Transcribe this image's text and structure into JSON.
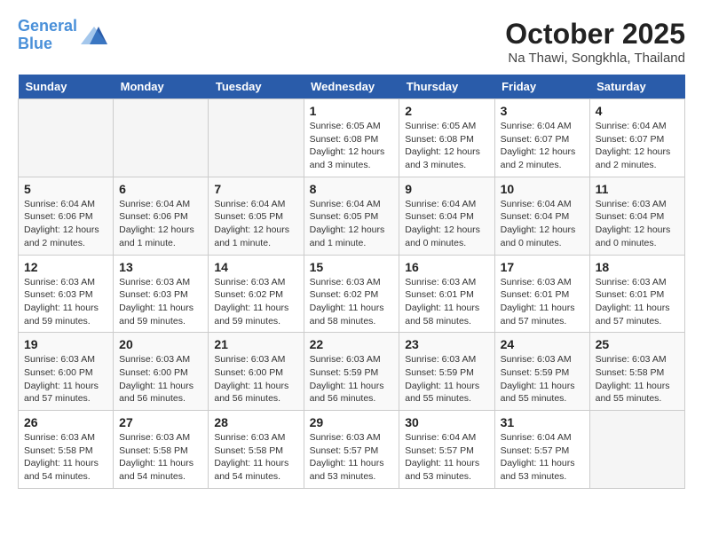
{
  "header": {
    "logo_line1": "General",
    "logo_line2": "Blue",
    "month_year": "October 2025",
    "location": "Na Thawi, Songkhla, Thailand"
  },
  "days_of_week": [
    "Sunday",
    "Monday",
    "Tuesday",
    "Wednesday",
    "Thursday",
    "Friday",
    "Saturday"
  ],
  "weeks": [
    [
      {
        "num": "",
        "info": ""
      },
      {
        "num": "",
        "info": ""
      },
      {
        "num": "",
        "info": ""
      },
      {
        "num": "1",
        "info": "Sunrise: 6:05 AM\nSunset: 6:08 PM\nDaylight: 12 hours and 3 minutes."
      },
      {
        "num": "2",
        "info": "Sunrise: 6:05 AM\nSunset: 6:08 PM\nDaylight: 12 hours and 3 minutes."
      },
      {
        "num": "3",
        "info": "Sunrise: 6:04 AM\nSunset: 6:07 PM\nDaylight: 12 hours and 2 minutes."
      },
      {
        "num": "4",
        "info": "Sunrise: 6:04 AM\nSunset: 6:07 PM\nDaylight: 12 hours and 2 minutes."
      }
    ],
    [
      {
        "num": "5",
        "info": "Sunrise: 6:04 AM\nSunset: 6:06 PM\nDaylight: 12 hours and 2 minutes."
      },
      {
        "num": "6",
        "info": "Sunrise: 6:04 AM\nSunset: 6:06 PM\nDaylight: 12 hours and 1 minute."
      },
      {
        "num": "7",
        "info": "Sunrise: 6:04 AM\nSunset: 6:05 PM\nDaylight: 12 hours and 1 minute."
      },
      {
        "num": "8",
        "info": "Sunrise: 6:04 AM\nSunset: 6:05 PM\nDaylight: 12 hours and 1 minute."
      },
      {
        "num": "9",
        "info": "Sunrise: 6:04 AM\nSunset: 6:04 PM\nDaylight: 12 hours and 0 minutes."
      },
      {
        "num": "10",
        "info": "Sunrise: 6:04 AM\nSunset: 6:04 PM\nDaylight: 12 hours and 0 minutes."
      },
      {
        "num": "11",
        "info": "Sunrise: 6:03 AM\nSunset: 6:04 PM\nDaylight: 12 hours and 0 minutes."
      }
    ],
    [
      {
        "num": "12",
        "info": "Sunrise: 6:03 AM\nSunset: 6:03 PM\nDaylight: 11 hours and 59 minutes."
      },
      {
        "num": "13",
        "info": "Sunrise: 6:03 AM\nSunset: 6:03 PM\nDaylight: 11 hours and 59 minutes."
      },
      {
        "num": "14",
        "info": "Sunrise: 6:03 AM\nSunset: 6:02 PM\nDaylight: 11 hours and 59 minutes."
      },
      {
        "num": "15",
        "info": "Sunrise: 6:03 AM\nSunset: 6:02 PM\nDaylight: 11 hours and 58 minutes."
      },
      {
        "num": "16",
        "info": "Sunrise: 6:03 AM\nSunset: 6:01 PM\nDaylight: 11 hours and 58 minutes."
      },
      {
        "num": "17",
        "info": "Sunrise: 6:03 AM\nSunset: 6:01 PM\nDaylight: 11 hours and 57 minutes."
      },
      {
        "num": "18",
        "info": "Sunrise: 6:03 AM\nSunset: 6:01 PM\nDaylight: 11 hours and 57 minutes."
      }
    ],
    [
      {
        "num": "19",
        "info": "Sunrise: 6:03 AM\nSunset: 6:00 PM\nDaylight: 11 hours and 57 minutes."
      },
      {
        "num": "20",
        "info": "Sunrise: 6:03 AM\nSunset: 6:00 PM\nDaylight: 11 hours and 56 minutes."
      },
      {
        "num": "21",
        "info": "Sunrise: 6:03 AM\nSunset: 6:00 PM\nDaylight: 11 hours and 56 minutes."
      },
      {
        "num": "22",
        "info": "Sunrise: 6:03 AM\nSunset: 5:59 PM\nDaylight: 11 hours and 56 minutes."
      },
      {
        "num": "23",
        "info": "Sunrise: 6:03 AM\nSunset: 5:59 PM\nDaylight: 11 hours and 55 minutes."
      },
      {
        "num": "24",
        "info": "Sunrise: 6:03 AM\nSunset: 5:59 PM\nDaylight: 11 hours and 55 minutes."
      },
      {
        "num": "25",
        "info": "Sunrise: 6:03 AM\nSunset: 5:58 PM\nDaylight: 11 hours and 55 minutes."
      }
    ],
    [
      {
        "num": "26",
        "info": "Sunrise: 6:03 AM\nSunset: 5:58 PM\nDaylight: 11 hours and 54 minutes."
      },
      {
        "num": "27",
        "info": "Sunrise: 6:03 AM\nSunset: 5:58 PM\nDaylight: 11 hours and 54 minutes."
      },
      {
        "num": "28",
        "info": "Sunrise: 6:03 AM\nSunset: 5:58 PM\nDaylight: 11 hours and 54 minutes."
      },
      {
        "num": "29",
        "info": "Sunrise: 6:03 AM\nSunset: 5:57 PM\nDaylight: 11 hours and 53 minutes."
      },
      {
        "num": "30",
        "info": "Sunrise: 6:04 AM\nSunset: 5:57 PM\nDaylight: 11 hours and 53 minutes."
      },
      {
        "num": "31",
        "info": "Sunrise: 6:04 AM\nSunset: 5:57 PM\nDaylight: 11 hours and 53 minutes."
      },
      {
        "num": "",
        "info": ""
      }
    ]
  ]
}
